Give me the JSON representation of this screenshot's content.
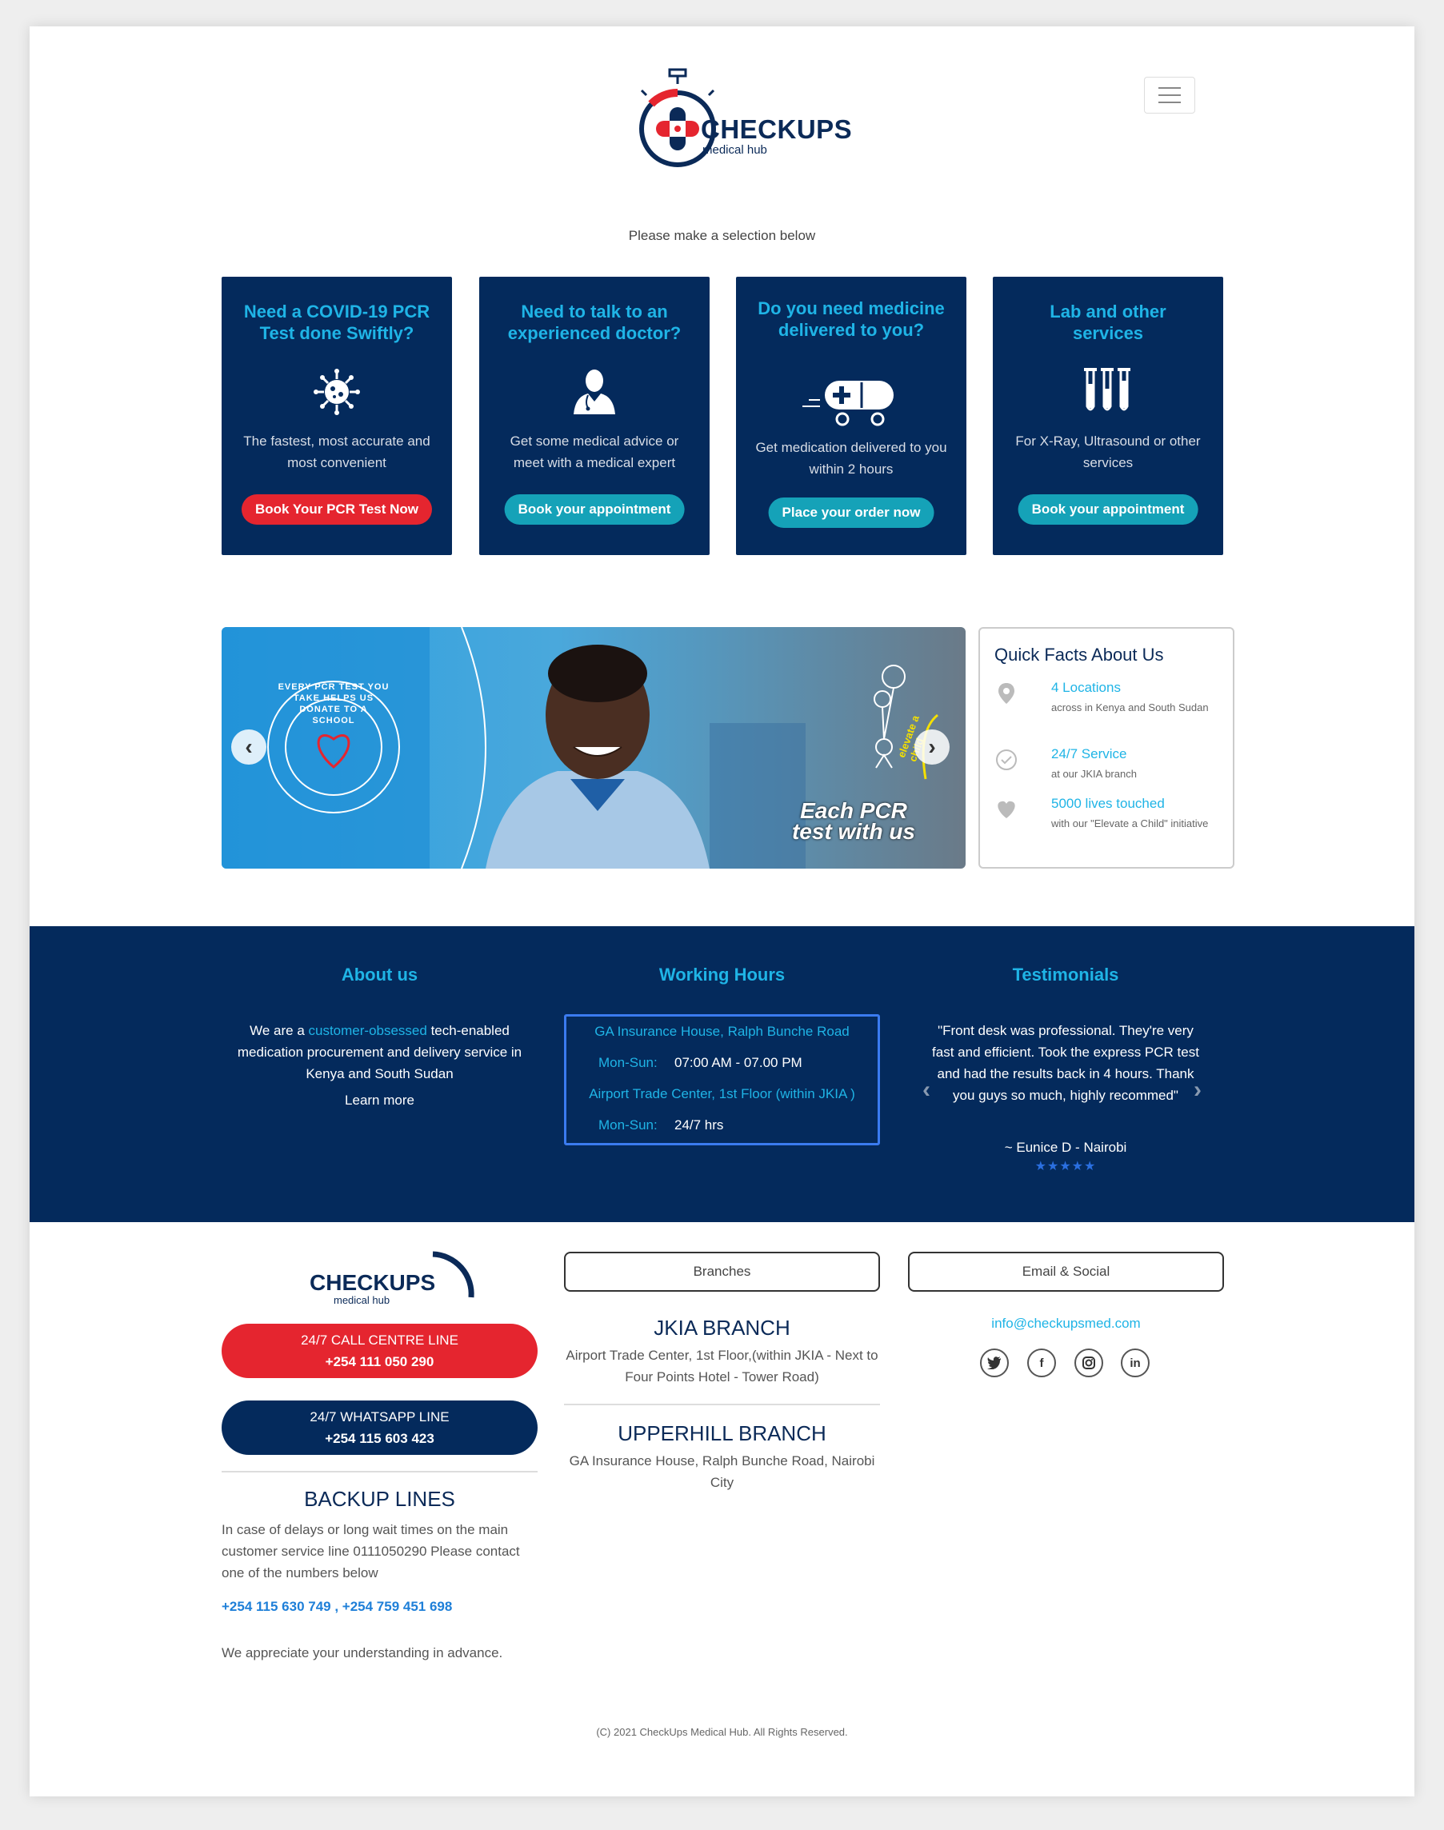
{
  "header": {
    "brand": "CHECKUPS",
    "brand_sub": "medical hub",
    "prompt": "Please make a selection below"
  },
  "cards": [
    {
      "title": "Need a COVID-19 PCR Test done Swiftly?",
      "desc": "The fastest, most accurate and most convenient",
      "button": "Book Your PCR Test Now",
      "icon": "virus-icon"
    },
    {
      "title": "Need to talk to an experienced doctor?",
      "desc": "Get some medical advice or meet with a medical expert",
      "button": "Book your appointment",
      "icon": "doctor-icon"
    },
    {
      "title": "Do you need medicine delivered to you?",
      "desc": "Get medication delivered to you within 2 hours",
      "button": "Place your order now",
      "icon": "delivery-van-icon"
    },
    {
      "title": "Lab and other services",
      "desc": "For X-Ray, Ultrasound or other services",
      "button": "Book your appointment",
      "icon": "test-tubes-icon"
    }
  ],
  "banner": {
    "circle_text": "EVERY PCR TEST YOU TAKE HELPS US DONATE TO A SCHOOL",
    "caption_line1": "Each PCR",
    "caption_line2": "test with us",
    "elevate_label": "elevate",
    "elevate_accent": "a child"
  },
  "facts": {
    "title": "Quick Facts About Us",
    "items": [
      {
        "title": "4 Locations",
        "desc": "across in Kenya and South Sudan",
        "icon": "location-pin-icon"
      },
      {
        "title": "24/7 Service",
        "desc": "at our JKIA branch",
        "icon": "check-circle-icon"
      },
      {
        "title": "5000 lives touched",
        "desc": "with our \"Elevate a Child\" initiative",
        "icon": "heart-icon"
      }
    ]
  },
  "about": {
    "heading": "About us",
    "text_before": "We are a ",
    "highlight": "customer-obsessed",
    "text_after": " tech-enabled medication procurement and delivery service in Kenya and South Sudan",
    "learn_more": "Learn more"
  },
  "hours": {
    "heading": "Working Hours",
    "entries": [
      {
        "location": "GA Insurance House, Ralph Bunche Road",
        "days": "Mon-Sun:",
        "time": "07:00 AM - 07.00 PM"
      },
      {
        "location": "Airport Trade Center, 1st Floor (within JKIA )",
        "days": "Mon-Sun:",
        "time": "24/7 hrs"
      }
    ]
  },
  "testimonials": {
    "heading": "Testimonials",
    "quote": "\"Front desk was professional. They're very fast and efficient. Took the express PCR test and had the results back in 4 hours. Thank you guys so much, highly recommed\"",
    "author": "~ Eunice D - Nairobi",
    "rating": 5
  },
  "footer": {
    "brand": "CHECKUPS",
    "brand_sub": "medical hub",
    "call_label": "24/7 CALL CENTRE LINE",
    "call_number": "+254 111 050 290",
    "whatsapp_label": "24/7 WHATSAPP LINE",
    "whatsapp_number": "+254 115 603 423",
    "backup_title": "BACKUP LINES",
    "backup_text": "In case of delays or long wait times on the main customer service line 0111050290 Please contact one of the numbers below",
    "backup_numbers": "+254 115 630 749 , +254 759 451 698",
    "backup_thanks": "We appreciate your understanding in advance.",
    "tabs": {
      "branches": "Branches",
      "email_social": "Email & Social"
    },
    "branches": [
      {
        "name": "JKIA BRANCH",
        "address": "Airport Trade Center, 1st Floor,(within JKIA - Next to Four Points Hotel - Tower Road)"
      },
      {
        "name": "UPPERHILL BRANCH",
        "address": "GA Insurance House, Ralph Bunche Road, Nairobi City"
      }
    ],
    "email": "info@checkupsmed.com",
    "social": [
      "twitter-icon",
      "facebook-icon",
      "instagram-icon",
      "linkedin-icon"
    ],
    "copyright": "(C) 2021 CheckUps Medical Hub. All Rights Reserved."
  },
  "colors": {
    "navy": "#042a5c",
    "accent_blue": "#1fb4e6",
    "red": "#e5252f",
    "teal": "#15a2b8"
  }
}
